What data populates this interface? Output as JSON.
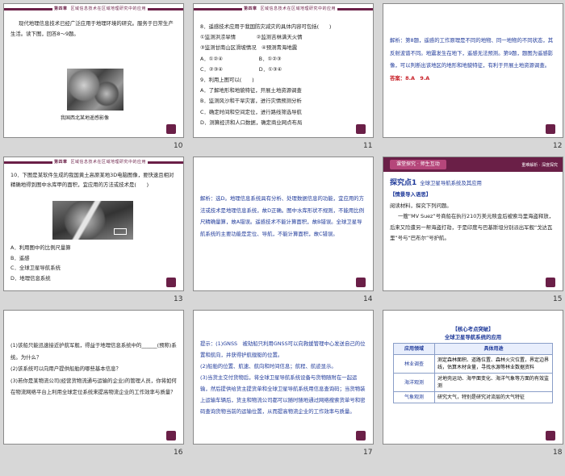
{
  "header_tag": {
    "part": "第四章",
    "title": "区域信息技术在区域地理研究中的应用"
  },
  "slides": [
    {
      "page": "10",
      "lines": [
        "现代地理信息技术已经广泛应用于地理环境的研究。服务于日常生产生活。读下图，回答8～9题。"
      ],
      "caption": "我国西北某地遥感影像"
    },
    {
      "page": "11",
      "lines": [
        "8．遥感技术应用于我国防灾减灾的具体内容可包括(　　)",
        "①监测洪涝旱情　　　　②监测吉林满天火情",
        "③监测甘南山区滑坡情况　④预测青海地震",
        "A．①②④　　　　　　　B．①②③",
        "C．②③④　　　　　　　D．①③④",
        "9．利用上图可以(　　)",
        "A．了解地形和地貌特征，开展土地资源调查",
        "B．监测风沙和干旱灾害，进行灾情预测分析",
        "C．确定时间和空间定位，进行路线筛选导航",
        "D．测算经济和人口数据，确定商业网点布局"
      ]
    },
    {
      "page": "12",
      "lines": [
        "解析：第8题，遥感的工作原理是不同的地物、同一地物的不同状态，其反射波谱不同。地震发生在地下，遥感无法预测。第9题，题图为遥感影像，可以判断出该地区的地形和地貌特征，有利于开展土地资源调查。"
      ],
      "answer": "答案：8.A　9.A"
    },
    {
      "page": "13",
      "lines": [
        "10．下图是某软件生成的我国黄土高原某地3D电脑图像，要快速且相对精确地得到图中水库甲的面积，宜应用的方法或技术是(　　)",
        "A．利用图中的比例尺量算",
        "B．遥感",
        "C．全球卫星导航系统",
        "D．地理信息系统"
      ]
    },
    {
      "page": "14",
      "lines": [
        "解析：选D。地理信息系统具有分析、处理数据信息的功能，宜应用的方法或技术是地理信息系统，故D正确。图中水库形状不规则，不能用比例尺精确量算，故A错误。遥感技术不能计算面积，故B错误。全球卫星导航系统的主要功能是定位、导航，不能计算面积，故C错误。"
      ]
    },
    {
      "page": "15",
      "section_pill": "课堂探究 · 师生互动",
      "section_right": "重难解析 · 深度探究",
      "explore_title": "探究点1",
      "explore_sub": "全球卫星导航系统及其应用",
      "lines": [
        "【情景导入语思】",
        "阅读材料，探究下列问题。",
        "一艘“MV Suez”号商船在执行210万美元赎金后被索马里海盗释放，后来又险遭另一帮海盗打劫，于是印度与巴基斯坦分别派出军舰“戈达瓦里”号与“巴布尔”号护航。"
      ]
    },
    {
      "page": "16",
      "lines": [
        "(1)该船只能迅速接近护航军舰，得益于地理信息系统中的______(预称)系统。为什么？",
        "(2)该系统可以向用户提供船舶的哪些基本信息？",
        "(3)若你是某物流公司(经营货物流通与运输的企业)的管理人员，你将如何在物流网络平台上利用全球定位系统来提高物流企业的工作效率与质量？"
      ]
    },
    {
      "page": "17",
      "lines": [
        "提示：(1)GNSS　被劫船只利用GNSS可以向救援管理中心发送自己的位置和航向，并获得护航舰艇的位置。",
        "(2)船舶的位置、航速、航向和时间信息；航程、航迹显示。",
        "(3)当货主交付货物后，将全球卫星导航系统设备与货物随附在一起运输，然后提供给货主提货单和全球卫星导航系统用信息查询码；当货物装上运输车辆后，货主和物流公司都可以随时随地通过网络搜索货单号和密码查询货物当前的运输位置，从而提高物流企业的工作效率与质量。"
      ]
    },
    {
      "page": "18",
      "tbl_head": "【核心考点突破】",
      "tbl_title": "全球卫星导航系统的应用",
      "tbl_cols": [
        "应用领域",
        "具体用途"
      ],
      "tbl_rows": [
        [
          "林业调查",
          "测定森林面积、道路位置、森林火灾位置，界定边界线，估算木材含量，寻找水源等林业数据资料"
        ],
        [
          "海洋观测",
          "对地壳运动、海平面变化、海洋气象等方面的有效监测"
        ],
        [
          "气象观测",
          "研究大气，特别是研究对流层的大气特征"
        ]
      ]
    }
  ]
}
